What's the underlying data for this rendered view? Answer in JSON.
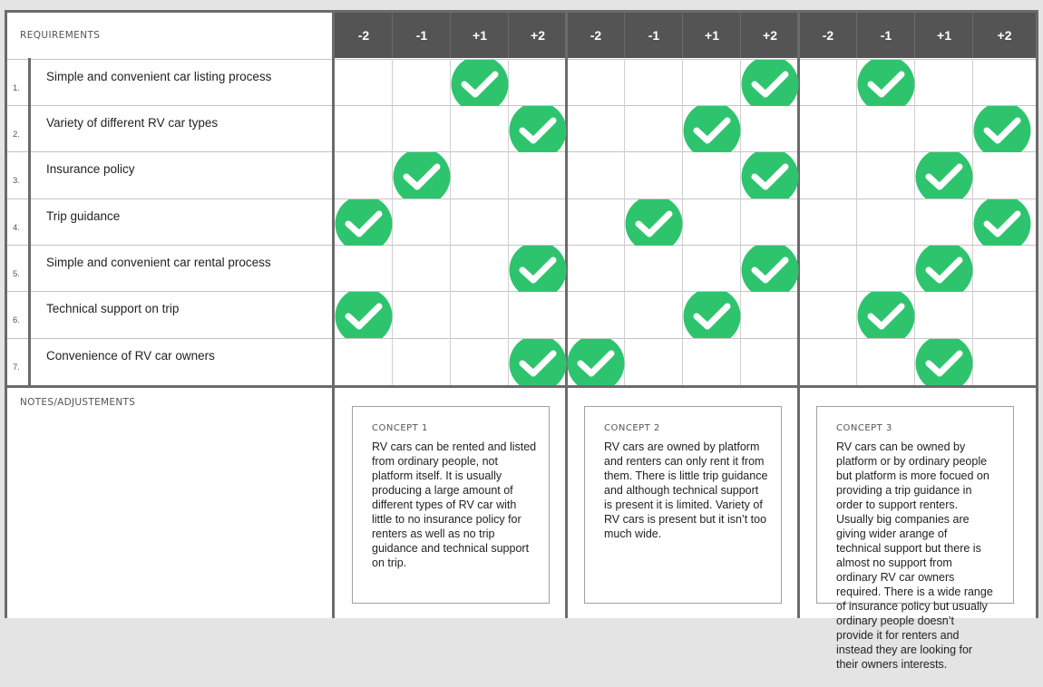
{
  "header": {
    "requirements_label": "REQUIREMENTS",
    "scores": [
      "-2",
      "-1",
      "+1",
      "+2",
      "-2",
      "-1",
      "+1",
      "+2",
      "-2",
      "-1",
      "+1",
      "+2"
    ]
  },
  "requirements": [
    {
      "num": "1.",
      "label": "Simple and convenient car listing process"
    },
    {
      "num": "2.",
      "label": "Variety of different RV car types"
    },
    {
      "num": "3.",
      "label": "Insurance policy"
    },
    {
      "num": "4.",
      "label": "Trip guidance"
    },
    {
      "num": "5.",
      "label": "Simple and convenient car rental process"
    },
    {
      "num": "6.",
      "label": "Technical support on trip"
    },
    {
      "num": "7.",
      "label": "Convenience of RV car owners"
    }
  ],
  "ratings": [
    [
      "+1",
      "+2",
      "-1"
    ],
    [
      "+2",
      "+1",
      "+2"
    ],
    [
      "-1",
      "+2",
      "+1"
    ],
    [
      "-2",
      "-1",
      "+2"
    ],
    [
      "+2",
      "+2",
      "+1"
    ],
    [
      "-2",
      "+1",
      "-1"
    ],
    [
      "+2",
      "-2",
      "+1"
    ]
  ],
  "check_color": "#2ec46e",
  "notes_label": "NOTES/ADJUSTEMENTS",
  "concepts": [
    {
      "title": "CONCEPT 1",
      "text": "RV cars can be rented and listed from ordinary people, not platform itself. It is usually producing a large amount of different types of RV car with little to no insurance policy for renters as well as no trip guidance and technical support on trip."
    },
    {
      "title": "CONCEPT 2",
      "text": "RV cars are owned by platform and renters can only rent it from them. There is little trip guidance and although technical support is present it is limited. Variety of RV cars is present but it isn’t too much wide."
    },
    {
      "title": "CONCEPT 3",
      "text": "RV cars can be owned by platform or by ordinary people but platform is more focued on providing a trip guidance in order to support renters. Usually big companies are giving wider arange of technical support but there is almost no support from ordinary RV car owners required. There is a wide range of insurance policy but usually ordinary people doesn’t provide it for renters and instead they are looking for their owners interests."
    }
  ]
}
